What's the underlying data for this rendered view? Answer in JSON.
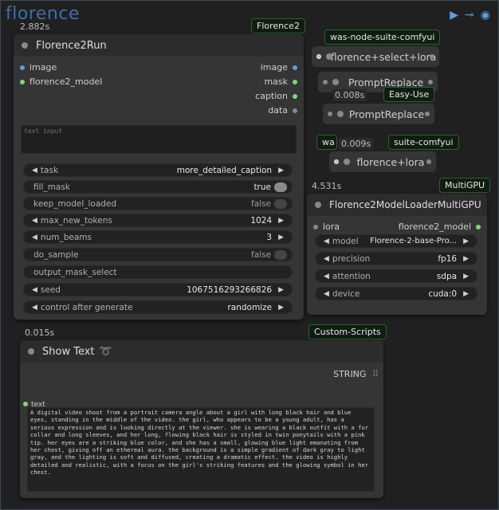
{
  "group": {
    "title": "florence"
  },
  "florence_node": {
    "time": "2.882s",
    "badge": "Florence2",
    "title": "Florence2Run",
    "inputs": [
      "image",
      "florence2_model"
    ],
    "outputs": [
      "image",
      "mask",
      "caption",
      "data"
    ],
    "text_placeholder": "text input",
    "widgets": [
      {
        "label": "task",
        "value": "more_detailed_caption",
        "kind": "combo"
      },
      {
        "label": "fill_mask",
        "value": "true",
        "kind": "toggle",
        "on": true
      },
      {
        "label": "keep_model_loaded",
        "value": "false",
        "kind": "toggle",
        "on": false
      },
      {
        "label": "max_new_tokens",
        "value": "1024",
        "kind": "number"
      },
      {
        "label": "num_beams",
        "value": "3",
        "kind": "number"
      },
      {
        "label": "do_sample",
        "value": "false",
        "kind": "toggle",
        "on": false
      },
      {
        "label": "output_mask_select",
        "value": "",
        "kind": "text"
      },
      {
        "label": "seed",
        "value": "1067516293266826",
        "kind": "number"
      },
      {
        "label": "control after generate",
        "value": "randomize",
        "kind": "combo"
      }
    ]
  },
  "was1": {
    "badge": "was-node-suite-comfyui",
    "title": "florence+select+lora"
  },
  "prompt1": {
    "title": "PromptReplace"
  },
  "easy": {
    "time": "0.008s",
    "badge": "Easy-Use",
    "title": "PromptReplace"
  },
  "was2": {
    "badge_left": "wa",
    "time": "0.009s",
    "badge_right": "suite-comfyui",
    "title": "florence+lora"
  },
  "loader": {
    "time": "4.531s",
    "badge": "MultiGPU",
    "title": "Florence2ModelLoaderMultiGPU",
    "input": "lora",
    "output": "florence2_model",
    "widgets": [
      {
        "label": "model",
        "value": "Florence-2-base-Pro..."
      },
      {
        "label": "precision",
        "value": "fp16"
      },
      {
        "label": "attention",
        "value": "sdpa"
      },
      {
        "label": "device",
        "value": "cuda:0"
      }
    ]
  },
  "show": {
    "time": "0.015s",
    "badge": "Custom-Scripts",
    "title": "Show Text",
    "output": "STRING",
    "input": "text",
    "text": "A digital video shoot from a portrait camera angle about a girl with long black hair and blue eyes, standing in the middle of the video. the girl, who appears to be a young adult, has a serious expression and is looking directly at the viewer. she is wearing a black outfit with a fur collar and long sleeves, and her long, flowing black hair is styled in twin ponytails with a pink tip. her eyes are a striking blue color, and she has a small, glowing blue light emanating from her chest, giving off an ethereal aura. the background is a simple gradient of dark gray to light gray, and the lighting is soft and diffused, creating a dramatic effect. the video is highly detailed and realistic, with a focus on the girl's striking features and the glowing symbol in her chest."
  },
  "colors": {
    "image": "#5aa0e0",
    "model": "#7dd87d",
    "mask": "#7dd87d",
    "caption": "#7dd87d",
    "data": "#888888"
  }
}
